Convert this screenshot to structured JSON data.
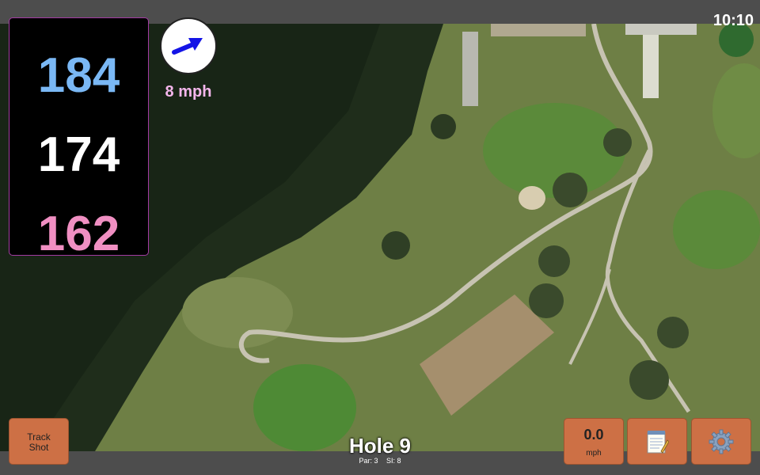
{
  "status": {
    "time": "10:10"
  },
  "distances": {
    "back": "184",
    "middle": "174",
    "front": "162"
  },
  "wind": {
    "speed": "8 mph",
    "icon": "arrow-icon"
  },
  "hole": {
    "title": "Hole 9",
    "par": "Par: 3",
    "stroke_index": "SI: 8"
  },
  "buttons": {
    "track_shot_line1": "Track",
    "track_shot_line2": "Shot",
    "speed_value": "0.0",
    "speed_unit": "mph",
    "notes_icon": "notepad-icon",
    "settings_icon": "gear-icon"
  },
  "colors": {
    "back_distance": "#7ab8f5",
    "middle_distance": "#ffffff",
    "front_distance": "#f08fc2",
    "button": "#cd7045",
    "wind_text": "#f4b6ec"
  }
}
